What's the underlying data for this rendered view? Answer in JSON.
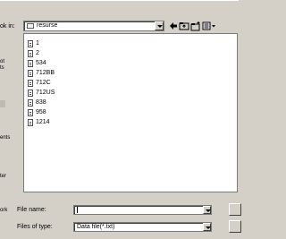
{
  "look_in": {
    "label": "ok in:",
    "value": "resurse"
  },
  "places_fragments": [
    "ot",
    "ts",
    "ents",
    "ter",
    "ork"
  ],
  "files": [
    "1",
    "2",
    "534",
    "712BB",
    "712C",
    "712US",
    "838",
    "958",
    "1214"
  ],
  "file_name": {
    "label": "File name:",
    "value": ""
  },
  "file_type": {
    "label": "Files of type:",
    "value": "Data file(*.txt)"
  },
  "toolbar_icons": [
    "back-icon",
    "up-folder-icon",
    "new-folder-icon",
    "view-menu-icon"
  ]
}
